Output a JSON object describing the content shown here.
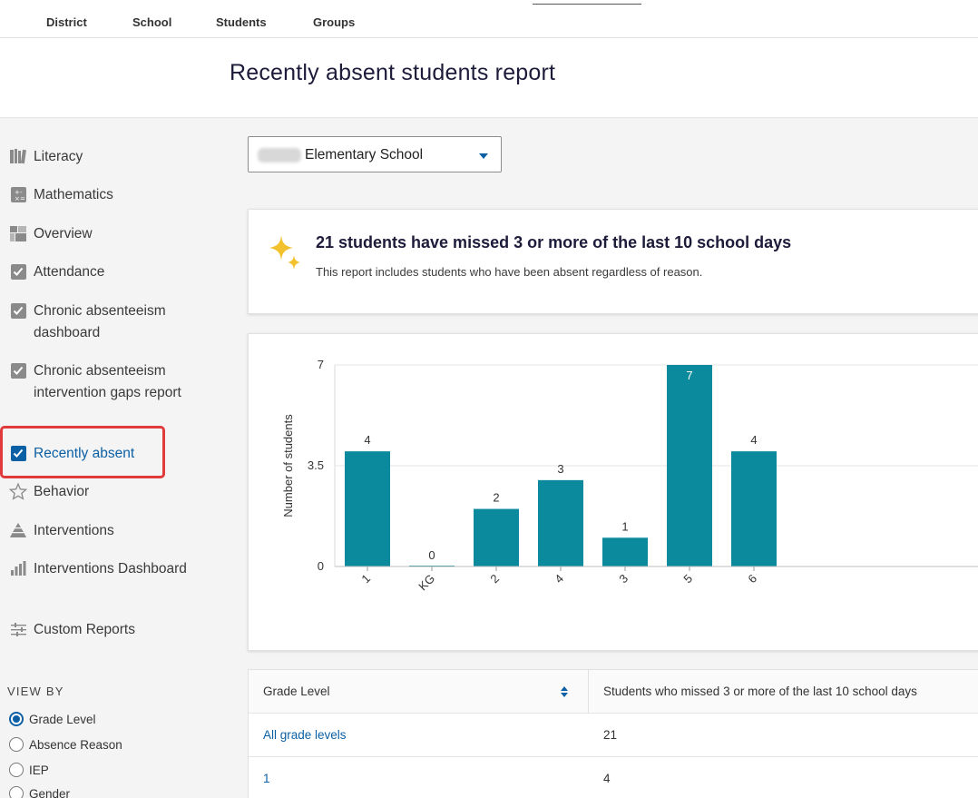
{
  "topnav": {
    "tabs": [
      {
        "label": "District"
      },
      {
        "label": "School"
      },
      {
        "label": "Students"
      },
      {
        "label": "Groups"
      }
    ]
  },
  "page": {
    "title": "Recently absent students report"
  },
  "sidebar": {
    "items": [
      {
        "label": "Literacy",
        "icon": "books-icon"
      },
      {
        "label": "Mathematics",
        "icon": "calculator-icon"
      },
      {
        "label": "Overview",
        "icon": "blocks-icon"
      },
      {
        "label": "Attendance",
        "icon": "checkbox-icon"
      },
      {
        "label": "Chronic absenteeism dashboard",
        "icon": "checkbox-icon"
      },
      {
        "label": "Chronic absenteeism intervention gaps report",
        "icon": "checkbox-icon"
      },
      {
        "label": "Recently absent",
        "icon": "checkbox-icon",
        "active": true
      },
      {
        "label": "Behavior",
        "icon": "star-icon"
      },
      {
        "label": "Interventions",
        "icon": "pyramid-icon"
      },
      {
        "label": "Interventions Dashboard",
        "icon": "bar-chart-icon"
      },
      {
        "label": "Custom Reports",
        "icon": "sliders-icon"
      }
    ],
    "view_by": {
      "heading": "VIEW BY",
      "options": [
        {
          "label": "Grade Level",
          "selected": true
        },
        {
          "label": "Absence Reason",
          "selected": false
        },
        {
          "label": "IEP",
          "selected": false
        },
        {
          "label": "Gender",
          "selected": false
        }
      ]
    }
  },
  "school_select": {
    "value": "Elementary School"
  },
  "summary": {
    "headline": "21 students have missed 3 or more of the last 10 school days",
    "subtext": "This report includes students who have been absent regardless of reason."
  },
  "chart_data": {
    "type": "bar",
    "categories": [
      "1",
      "KG",
      "2",
      "4",
      "3",
      "5",
      "6"
    ],
    "values": [
      4,
      0,
      2,
      3,
      1,
      7,
      4
    ],
    "title": "",
    "xlabel": "",
    "ylabel": "Number of students",
    "ylim": [
      0,
      7
    ],
    "yticks": [
      "0",
      "3.5",
      "7"
    ],
    "bar_color": "#0b8a9e",
    "grid": true
  },
  "table": {
    "headers": [
      "Grade Level",
      "Students who missed 3 or more of the last 10 school days"
    ],
    "rows": [
      {
        "grade": "All grade levels",
        "count": "21"
      },
      {
        "grade": "1",
        "count": "4"
      }
    ]
  },
  "colors": {
    "accent": "#0b5fa5",
    "highlight": "#e03a3a",
    "bar": "#0b8a9e",
    "sparkle": "#f2c12e"
  }
}
